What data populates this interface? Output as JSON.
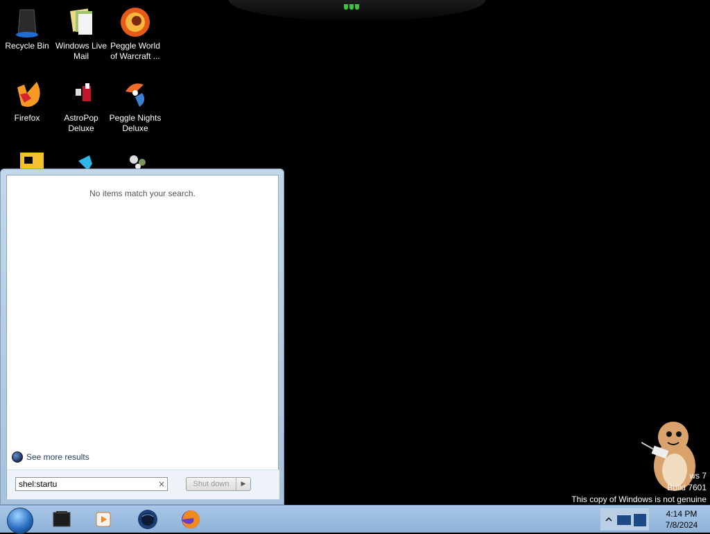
{
  "desktop": {
    "icons": [
      {
        "label": "Recycle Bin",
        "icon": "recycle-bin-icon"
      },
      {
        "label": "Windows Live Mail",
        "icon": "mail-icon"
      },
      {
        "label": "Peggle World of Warcraft ...",
        "icon": "peggle-wow-icon"
      },
      {
        "label": "Firefox",
        "icon": "firefox-icon"
      },
      {
        "label": "AstroPop Deluxe",
        "icon": "astropop-icon"
      },
      {
        "label": "Peggle Nights Deluxe",
        "icon": "peggle-nights-icon"
      }
    ]
  },
  "start_menu": {
    "no_results_text": "No items match your search.",
    "see_more_label": "See more results",
    "search_value": "shel:startu",
    "clear_symbol": "×",
    "shutdown_label": "Shut down"
  },
  "taskbar": {
    "pinned": [
      {
        "icon": "window-app-icon"
      },
      {
        "icon": "media-player-icon"
      },
      {
        "icon": "game-globe-icon"
      },
      {
        "icon": "firefox-icon"
      }
    ],
    "clock_time": "4:14 PM",
    "clock_date": "7/8/2024"
  },
  "watermark": {
    "line1": "ws 7",
    "line2": "Build 7601",
    "line3": "This copy of Windows is not genuine"
  },
  "colors": {
    "taskbar": "#a9c7e6",
    "start_menu": "#b8cfe6",
    "desktop": "#000000"
  }
}
